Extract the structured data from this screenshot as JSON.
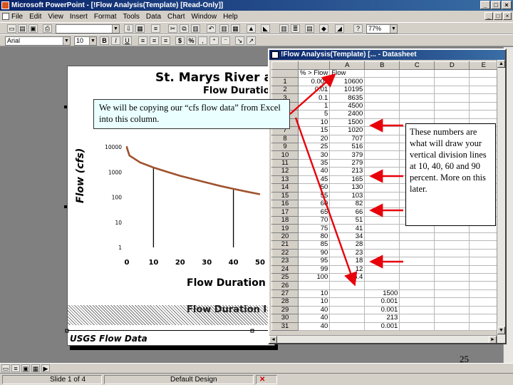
{
  "app": {
    "title": "Microsoft PowerPoint - [!Flow Analysis(Template) [Read-Only]]",
    "window_buttons": [
      "_",
      "□",
      "×"
    ]
  },
  "menu": {
    "items": [
      "File",
      "Edit",
      "View",
      "Insert",
      "Format",
      "Tools",
      "Data",
      "Chart",
      "Window",
      "Help"
    ]
  },
  "toolbar": {
    "font_name": "Arial",
    "font_size": "10",
    "bold": "B",
    "italic": "I",
    "underline": "U",
    "currency": "$",
    "percent": "%",
    "zoom": "77%"
  },
  "slide": {
    "title": "St. Marys River at",
    "subtitle": "Flow Duration",
    "y_axis_label": "Flow (cfs)",
    "x_axis_label": "Flow Duration I",
    "hatch_label": "Flow Duration I",
    "footer": "USGS Flow Data"
  },
  "chart_data": {
    "type": "line",
    "xlabel": "Flow Duration I",
    "ylabel": "Flow (cfs)",
    "x_ticks": [
      "0",
      "10",
      "20",
      "30",
      "40",
      "50"
    ],
    "y_ticks": [
      "1",
      "10",
      "100",
      "1000",
      "10000"
    ],
    "y_scale": "log",
    "xlim": [
      0,
      50
    ],
    "ylim": [
      1,
      10000
    ],
    "x": [
      0.005,
      0.01,
      0.1,
      1,
      5,
      10,
      15,
      20,
      25,
      30,
      35,
      40,
      45,
      50
    ],
    "y": [
      10600,
      10195,
      8635,
      4500,
      2400,
      1500,
      1020,
      707,
      516,
      379,
      279,
      213,
      165,
      130
    ],
    "vertical_lines": [
      10,
      40
    ],
    "line_color": "#a0522d"
  },
  "callouts": {
    "copy": "We will be copying our “cfs flow data” from Excel into this column.",
    "numbers": "These numbers are what will draw your vertical division lines at 10, 40, 60 and 90 percent.  More on this later."
  },
  "datasheet": {
    "title": "!Flow Analysis(Template) [... - Datasheet",
    "columns": [
      "A",
      "B",
      "C",
      "D",
      "E"
    ],
    "rows": [
      {
        "n": "",
        "label": "% > Flow",
        "a": "Flow",
        "b": ""
      },
      {
        "n": "1",
        "label": "0.005",
        "a": "10600",
        "b": ""
      },
      {
        "n": "2",
        "label": "0.01",
        "a": "10195",
        "b": ""
      },
      {
        "n": "3",
        "label": "0.1",
        "a": "8635",
        "b": ""
      },
      {
        "n": "4",
        "label": "1",
        "a": "4500",
        "b": ""
      },
      {
        "n": "5",
        "label": "5",
        "a": "2400",
        "b": ""
      },
      {
        "n": "6",
        "label": "10",
        "a": "1500",
        "b": ""
      },
      {
        "n": "7",
        "label": "15",
        "a": "1020",
        "b": ""
      },
      {
        "n": "8",
        "label": "20",
        "a": "707",
        "b": ""
      },
      {
        "n": "9",
        "label": "25",
        "a": "516",
        "b": ""
      },
      {
        "n": "10",
        "label": "30",
        "a": "379",
        "b": ""
      },
      {
        "n": "11",
        "label": "35",
        "a": "279",
        "b": ""
      },
      {
        "n": "12",
        "label": "40",
        "a": "213",
        "b": ""
      },
      {
        "n": "13",
        "label": "45",
        "a": "165",
        "b": ""
      },
      {
        "n": "14",
        "label": "50",
        "a": "130",
        "b": ""
      },
      {
        "n": "15",
        "label": "55",
        "a": "103",
        "b": ""
      },
      {
        "n": "16",
        "label": "60",
        "a": "82",
        "b": ""
      },
      {
        "n": "17",
        "label": "65",
        "a": "66",
        "b": ""
      },
      {
        "n": "18",
        "label": "70",
        "a": "51",
        "b": ""
      },
      {
        "n": "19",
        "label": "75",
        "a": "41",
        "b": ""
      },
      {
        "n": "20",
        "label": "80",
        "a": "34",
        "b": ""
      },
      {
        "n": "21",
        "label": "85",
        "a": "28",
        "b": ""
      },
      {
        "n": "22",
        "label": "90",
        "a": "23",
        "b": ""
      },
      {
        "n": "23",
        "label": "95",
        "a": "18",
        "b": ""
      },
      {
        "n": "24",
        "label": "99",
        "a": "12",
        "b": ""
      },
      {
        "n": "25",
        "label": "100",
        "a": "5.4",
        "b": ""
      },
      {
        "n": "26",
        "label": "",
        "a": "",
        "b": ""
      },
      {
        "n": "27",
        "label": "10",
        "a": "",
        "b": "1500"
      },
      {
        "n": "28",
        "label": "10",
        "a": "",
        "b": "0.001"
      },
      {
        "n": "29",
        "label": "40",
        "a": "",
        "b": "0.001"
      },
      {
        "n": "30",
        "label": "40",
        "a": "",
        "b": "213"
      },
      {
        "n": "31",
        "label": "40",
        "a": "",
        "b": "0.001"
      }
    ]
  },
  "page_number": "25",
  "status": {
    "slide": "Slide 1 of 4",
    "design": "Default Design"
  }
}
